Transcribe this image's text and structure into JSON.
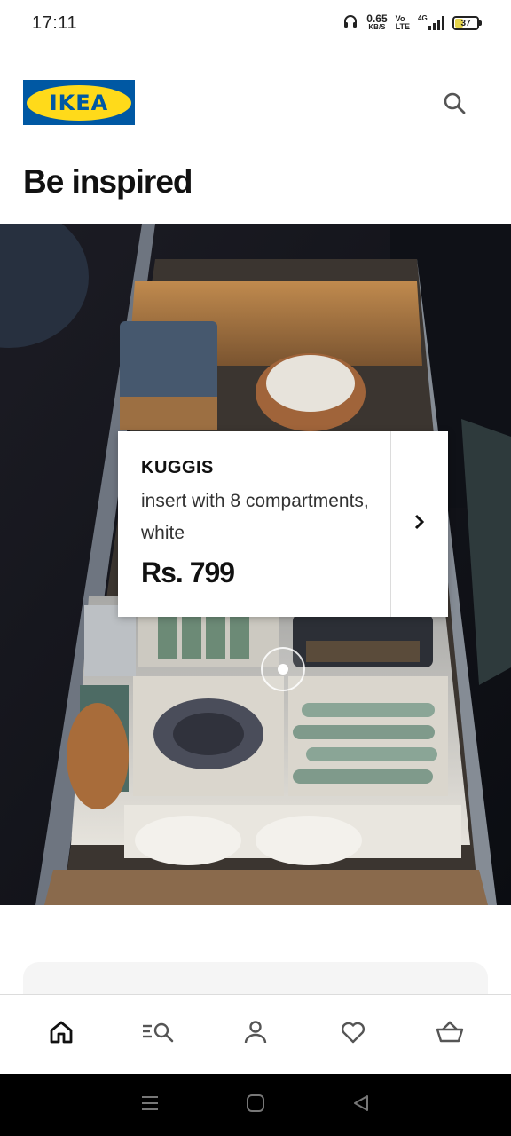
{
  "status_bar": {
    "time": "17:11",
    "net_speed_value": "0.65",
    "net_speed_unit": "KB/S",
    "volte_top": "Vo",
    "volte_bottom": "LTE",
    "network_type": "4G",
    "battery_level": "37",
    "icons": [
      "headphones-icon",
      "signal-icon",
      "battery-icon"
    ]
  },
  "header": {
    "logo_text": "IKEA",
    "search_icon": "search-icon"
  },
  "page": {
    "title": "Be inspired"
  },
  "hero": {
    "image": "drawer-organizer-photo",
    "hotspot_icon": "hotspot-dot-icon"
  },
  "product_card": {
    "name": "KUGGIS",
    "description": "insert with 8 compartments, white",
    "price": "Rs. 799",
    "arrow_icon": "chevron-right-icon"
  },
  "bottom_nav": {
    "items": [
      {
        "name": "home",
        "icon": "home-icon",
        "active": true
      },
      {
        "name": "search-products",
        "icon": "list-search-icon",
        "active": false
      },
      {
        "name": "profile",
        "icon": "user-icon",
        "active": false
      },
      {
        "name": "favourites",
        "icon": "heart-icon",
        "active": false
      },
      {
        "name": "cart",
        "icon": "basket-icon",
        "active": false
      }
    ]
  },
  "system_nav": {
    "icons": [
      "menu-icon",
      "home-square-icon",
      "back-icon"
    ]
  },
  "colors": {
    "ikea_blue": "#0058a3",
    "ikea_yellow": "#ffda1a",
    "battery_fill": "#e4d34a",
    "nav_bar": "#000000"
  }
}
